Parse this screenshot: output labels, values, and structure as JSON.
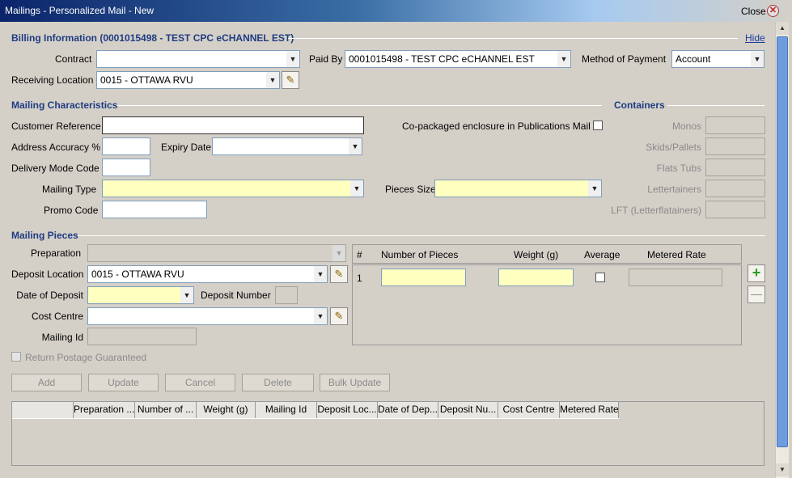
{
  "window": {
    "title": "Mailings - Personalized Mail - New",
    "close_label": "Close",
    "close_icon": "close-icon"
  },
  "billing": {
    "heading": "Billing Information  (0001015498 - TEST CPC eCHANNEL EST)",
    "hide_label": "Hide",
    "contract_label": "Contract",
    "contract_value": "",
    "paid_by_label": "Paid By",
    "paid_by_value": "0001015498 - TEST CPC eCHANNEL EST",
    "method_label": "Method of Payment",
    "method_value": "Account",
    "receiving_label": "Receiving Location",
    "receiving_value": "0015 - OTTAWA RVU"
  },
  "characteristics": {
    "heading": "Mailing Characteristics",
    "customer_ref_label": "Customer Reference",
    "customer_ref_value": "",
    "address_acc_label": "Address Accuracy %",
    "address_acc_value": "",
    "expiry_label": "Expiry Date",
    "expiry_value": "",
    "delivery_mode_label": "Delivery Mode Code",
    "delivery_mode_value": "",
    "mailing_type_label": "Mailing Type",
    "mailing_type_value": "",
    "promo_label": "Promo Code",
    "promo_value": "",
    "copackaged_label": "Co-packaged enclosure in Publications Mail",
    "copackaged_checked": false,
    "pieces_size_label": "Pieces Size",
    "pieces_size_value": ""
  },
  "containers": {
    "heading": "Containers",
    "monos_label": "Monos",
    "skids_label": "Skids/Pallets",
    "flats_label": "Flats Tubs",
    "lettertainers_label": "Lettertainers",
    "lft_label": "LFT (Letterflatainers)"
  },
  "pieces": {
    "heading": "Mailing Pieces",
    "preparation_label": "Preparation",
    "preparation_value": "",
    "deposit_loc_label": "Deposit Location",
    "deposit_loc_value": "0015 - OTTAWA RVU",
    "date_label": "Date of Deposit",
    "date_value": "",
    "deposit_num_label": "Deposit Number",
    "deposit_num_value": "",
    "cost_centre_label": "Cost Centre",
    "cost_centre_value": "",
    "mailing_id_label": "Mailing Id",
    "mailing_id_value": "",
    "return_postage_label": "Return Postage Guaranteed",
    "grid_headers": {
      "num": "#",
      "pieces": "Number of Pieces",
      "weight": "Weight (g)",
      "average": "Average",
      "metered": "Metered Rate"
    },
    "grid_row_index": "1"
  },
  "actions": {
    "add": "Add",
    "update": "Update",
    "cancel": "Cancel",
    "delete": "Delete",
    "bulk_update": "Bulk Update"
  },
  "table": {
    "columns": [
      "",
      "Preparation ...",
      "Number of ...",
      "Weight (g)",
      "Mailing Id",
      "Deposit Loc...",
      "Date of Dep...",
      "Deposit Nu...",
      "Cost Centre",
      "Metered Rate"
    ]
  }
}
